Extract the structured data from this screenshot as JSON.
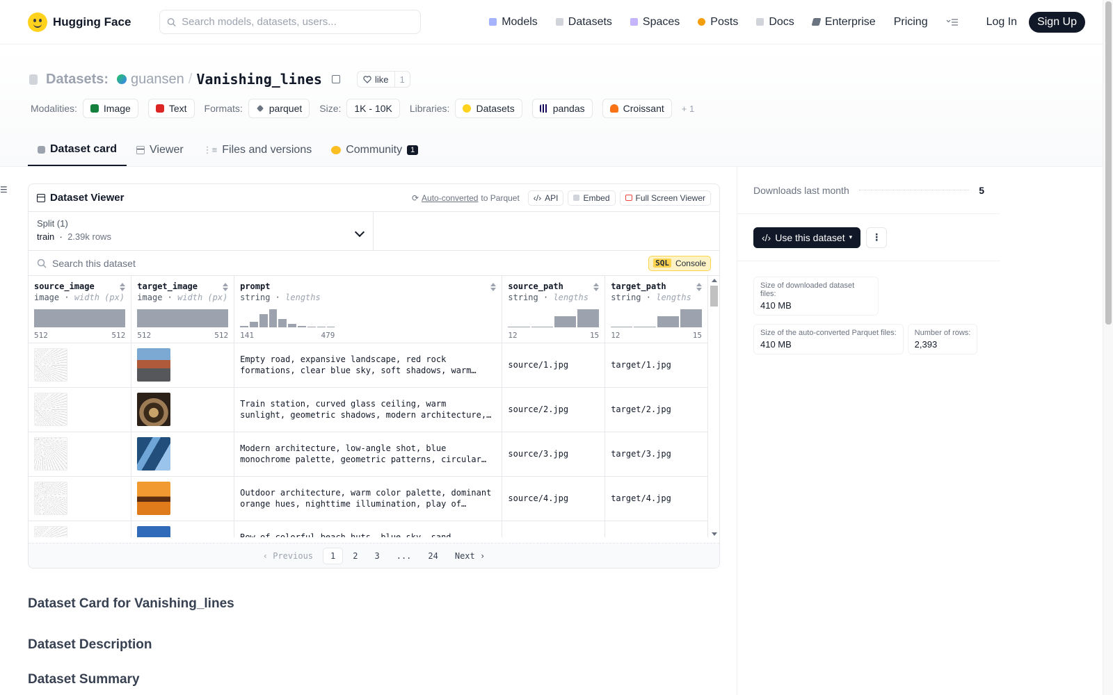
{
  "nav": {
    "brand": "Hugging Face",
    "search_placeholder": "Search models, datasets, users...",
    "links": [
      {
        "label": "Models",
        "color": "#a5b4fc"
      },
      {
        "label": "Datasets",
        "color": "#d1d5db"
      },
      {
        "label": "Spaces",
        "color": "#c4b5fd"
      },
      {
        "label": "Posts",
        "color": "#f59e0b"
      },
      {
        "label": "Docs",
        "color": "#d1d5db"
      },
      {
        "label": "Enterprise",
        "color": "#6b7280"
      },
      {
        "label": "Pricing",
        "color": ""
      }
    ],
    "login": "Log In",
    "signup": "Sign Up"
  },
  "repo": {
    "type_label": "Datasets:",
    "owner": "guansen",
    "slash": "/",
    "name": "Vanishing_lines",
    "like_label": "like",
    "like_count": "1"
  },
  "tags": {
    "modalities_label": "Modalities:",
    "modalities": [
      "Image",
      "Text"
    ],
    "formats_label": "Formats:",
    "formats": [
      "parquet"
    ],
    "size_label": "Size:",
    "size": "1K - 10K",
    "libraries_label": "Libraries:",
    "libraries": [
      "Datasets",
      "pandas",
      "Croissant"
    ],
    "more": "+ 1"
  },
  "tabs": [
    {
      "label": "Dataset card",
      "active": true
    },
    {
      "label": "Viewer"
    },
    {
      "label": "Files and versions"
    },
    {
      "label": "Community",
      "badge": "1"
    }
  ],
  "viewer": {
    "title": "Dataset Viewer",
    "auto_converted": "Auto-converted",
    "to_parquet": "to Parquet",
    "api": "API",
    "embed": "Embed",
    "fullscreen": "Full Screen Viewer",
    "split_label": "Split (1)",
    "split_name": "train",
    "split_rows": "2.39k rows",
    "search_placeholder": "Search this dataset",
    "sql": "SQL",
    "console": "Console",
    "columns": [
      {
        "name": "source_image",
        "type": "image",
        "stat": "width (px)",
        "min": "512",
        "max": "512"
      },
      {
        "name": "target_image",
        "type": "image",
        "stat": "width (px)",
        "min": "512",
        "max": "512"
      },
      {
        "name": "prompt",
        "type": "string",
        "stat": "lengths",
        "min": "141",
        "max": "479"
      },
      {
        "name": "source_path",
        "type": "string",
        "stat": "lengths",
        "min": "12",
        "max": "15"
      },
      {
        "name": "target_path",
        "type": "string",
        "stat": "lengths",
        "min": "12",
        "max": "15"
      }
    ],
    "histograms": {
      "source_image": [
        1
      ],
      "target_image": [
        1
      ],
      "prompt": [
        0.08,
        0.3,
        0.75,
        1,
        0.45,
        0.2,
        0.06,
        0.04,
        0.03,
        0.02
      ],
      "source_path": [
        0.04,
        0.05,
        0.6,
        1
      ],
      "target_path": [
        0.04,
        0.05,
        0.6,
        1
      ]
    },
    "rows": [
      {
        "prompt": "Empty road, expansive landscape, red rock formations, clear blue sky, soft shadows, warm…",
        "source_path": "source/1.jpg",
        "target_path": "target/1.jpg"
      },
      {
        "prompt": "Train station, curved glass ceiling, warm sunlight, geometric shadows, modern architecture, angular…",
        "source_path": "source/2.jpg",
        "target_path": "target/2.jpg"
      },
      {
        "prompt": "Modern architecture, low-angle shot, blue monochrome palette, geometric patterns, circular window…",
        "source_path": "source/3.jpg",
        "target_path": "target/3.jpg"
      },
      {
        "prompt": "Outdoor architecture, warm color palette, dominant orange hues, nighttime illumination, play of light…",
        "source_path": "source/4.jpg",
        "target_path": "target/4.jpg"
      },
      {
        "prompt": "Row of colorful beach huts, blue sky, sand, bright…",
        "source_path": "",
        "target_path": ""
      }
    ],
    "pager": {
      "prev": "Previous",
      "pages": [
        "1",
        "2",
        "3",
        "...",
        "24"
      ],
      "next": "Next"
    }
  },
  "card": {
    "h1": "Dataset Card for Vanishing_lines",
    "h2": "Dataset Description",
    "h3": "Dataset Summary"
  },
  "sidebar": {
    "downloads_label": "Downloads last month",
    "downloads": "5",
    "use_button": "Use this dataset",
    "size_download_label": "Size of downloaded dataset files:",
    "size_download": "410 MB",
    "size_parquet_label": "Size of the auto-converted Parquet files:",
    "size_parquet": "410 MB",
    "rows_label": "Number of rows:",
    "rows": "2,393"
  }
}
